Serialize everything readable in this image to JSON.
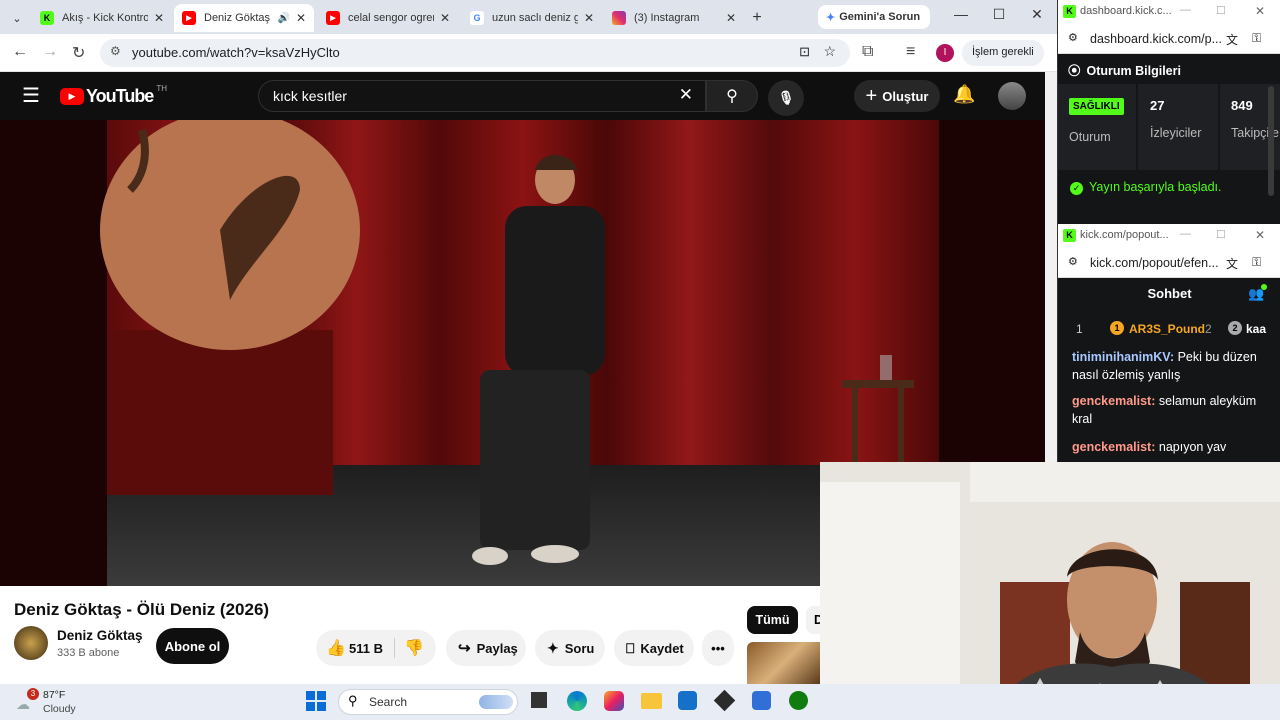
{
  "browser": {
    "tabs": [
      {
        "title": "Akış - Kick Kontrol",
        "active": false
      },
      {
        "title": "Deniz Göktaş - Ö",
        "active": true
      },
      {
        "title": "celal sengor ogrenc",
        "active": false
      },
      {
        "title": "uzun saclı deniz gö",
        "active": false
      },
      {
        "title": "(3) Instagram",
        "active": false
      }
    ],
    "gemini_label": "Gemini'a Sorun",
    "url": "youtube.com/watch?v=ksaVzHyClto",
    "action_required": "İşlem gerekli",
    "profile_initial": "I"
  },
  "youtube": {
    "logo_text": "YouTube",
    "country": "TH",
    "search_value": "kıck kesıtler",
    "create_label": "Oluştur",
    "video_title": "Deniz Göktaş - Ölü Deniz (2026)",
    "channel_name": "Deniz Göktaş",
    "subscribers": "333 B abone",
    "subscribe_label": "Abone ol",
    "likes": "511 B",
    "share_label": "Paylaş",
    "ask_label": "Soru",
    "save_label": "Kaydet",
    "filter_all": "Tümü",
    "filter_next": "D"
  },
  "kick_dashboard": {
    "window_title": "dashboard.kick.c...",
    "url": "dashboard.kick.com/p...",
    "section_title": "Oturum Bilgileri",
    "health_badge": "SAĞLIKLI",
    "session_label": "Oturum",
    "viewers_value": "27",
    "viewers_label": "İzleyiciler",
    "followers_value": "849",
    "followers_label": "Takipçile",
    "toast": "Yayın başarıyla başladı."
  },
  "kick_chat": {
    "window_title": "kick.com/popout...",
    "url": "kick.com/popout/efen...",
    "title": "Sohbet",
    "leader_rank": "1",
    "leader1_badge": "1",
    "leader1_name": "AR3S_Pound",
    "leader1_count": "2",
    "leader2_badge": "2",
    "leader2_name": "kaa",
    "messages": [
      {
        "user": "tiniminihanimKV",
        "text": "Peki bu düzen nasıl özlemiş yanlış",
        "color": "#a8c8ff"
      },
      {
        "user": "genckemalist",
        "text": "selamun aleyküm kral",
        "color": "#ff9a8a"
      },
      {
        "user": "genckemalist",
        "text": "napıyon yav",
        "color": "#ff9a8a"
      }
    ]
  },
  "taskbar": {
    "weather_temp": "87°F",
    "weather_desc": "Cloudy",
    "weather_badge": "3",
    "search_label": "Search"
  },
  "colors": {
    "kick_green": "#53fc18",
    "youtube_red": "#ff0000"
  }
}
